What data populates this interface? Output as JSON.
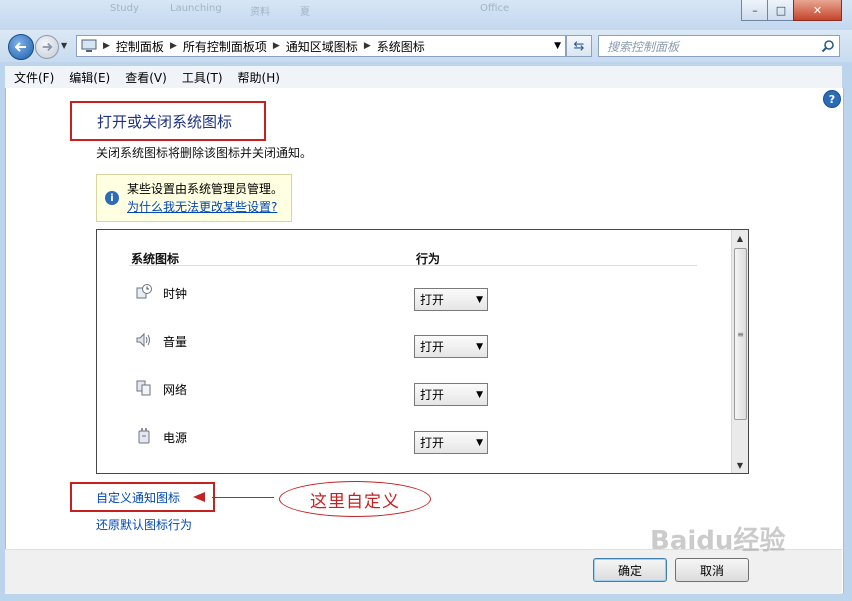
{
  "window": {
    "taskbar_ghost": [
      "Study",
      "Launching",
      "资料",
      "夏",
      "",
      "",
      "Office"
    ],
    "minimize": "–",
    "maximize": "□",
    "close": "✕"
  },
  "nav": {
    "back_icon": "back-arrow-icon",
    "forward_icon": "forward-arrow-icon",
    "breadcrumbs": [
      "控制面板",
      "所有控制面板项",
      "通知区域图标",
      "系统图标"
    ],
    "search_placeholder": "搜索控制面板"
  },
  "menu": [
    "文件(F)",
    "编辑(E)",
    "查看(V)",
    "工具(T)",
    "帮助(H)"
  ],
  "page": {
    "title": "打开或关闭系统图标",
    "description": "关闭系统图标将删除该图标并关闭通知。",
    "info_text": "某些设置由系统管理员管理。",
    "info_link": "为什么我无法更改某些设置?"
  },
  "table": {
    "col_icon": "系统图标",
    "col_behavior": "行为",
    "rows": [
      {
        "label": "时钟",
        "icon": "clock-icon",
        "value": "打开"
      },
      {
        "label": "音量",
        "icon": "volume-icon",
        "value": "打开"
      },
      {
        "label": "网络",
        "icon": "network-icon",
        "value": "打开"
      },
      {
        "label": "电源",
        "icon": "power-icon",
        "value": "打开"
      }
    ]
  },
  "links": {
    "customize": "自定义通知图标",
    "restore": "还原默认图标行为"
  },
  "annotation": "这里自定义",
  "buttons": {
    "ok": "确定",
    "cancel": "取消"
  },
  "watermark": "Baidu经验",
  "colors": {
    "annotation_red": "#c62020",
    "link_blue": "#0047b9",
    "title_blue": "#1e3287"
  }
}
